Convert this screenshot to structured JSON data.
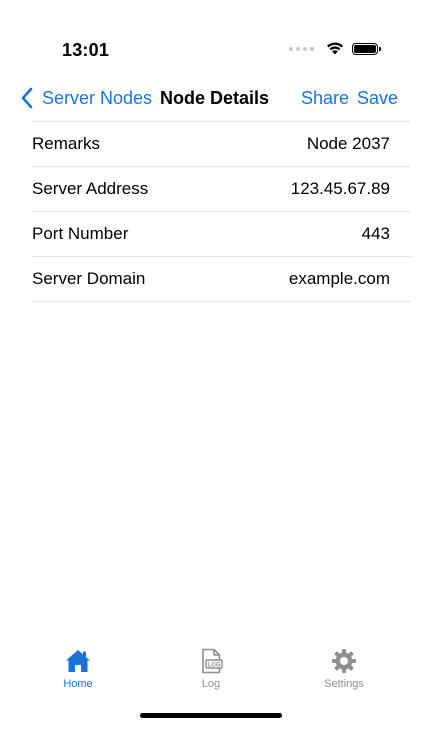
{
  "status_bar": {
    "time": "13:01"
  },
  "nav": {
    "back_label": "Server Nodes",
    "title": "Node Details",
    "share_label": "Share",
    "save_label": "Save"
  },
  "rows": [
    {
      "label": "Remarks",
      "value": "Node 2037"
    },
    {
      "label": "Server Address",
      "value": "123.45.67.89"
    },
    {
      "label": "Port Number",
      "value": "443"
    },
    {
      "label": "Server Domain",
      "value": "example.com"
    }
  ],
  "tabs": [
    {
      "label": "Home",
      "icon": "home-icon",
      "active": true
    },
    {
      "label": "Log",
      "icon": "log-icon",
      "active": false
    },
    {
      "label": "Settings",
      "icon": "gear-icon",
      "active": false
    }
  ],
  "log_icon_text": "LOG",
  "colors": {
    "accent": "#1a73d9",
    "inactive": "#8e8e93",
    "separator": "#e5e5ea"
  }
}
